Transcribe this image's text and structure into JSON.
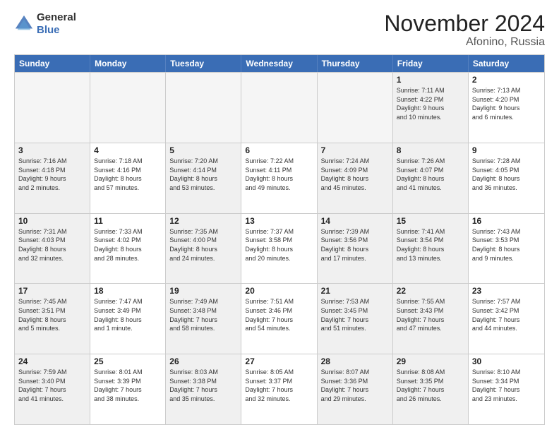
{
  "logo": {
    "line1": "General",
    "line2": "Blue"
  },
  "title": "November 2024",
  "subtitle": "Afonino, Russia",
  "calendar": {
    "headers": [
      "Sunday",
      "Monday",
      "Tuesday",
      "Wednesday",
      "Thursday",
      "Friday",
      "Saturday"
    ],
    "rows": [
      [
        {
          "day": "",
          "empty": true
        },
        {
          "day": "",
          "empty": true
        },
        {
          "day": "",
          "empty": true
        },
        {
          "day": "",
          "empty": true
        },
        {
          "day": "",
          "empty": true
        },
        {
          "day": "1",
          "text": "Sunrise: 7:11 AM\nSunset: 4:22 PM\nDaylight: 9 hours\nand 10 minutes.",
          "shaded": true
        },
        {
          "day": "2",
          "text": "Sunrise: 7:13 AM\nSunset: 4:20 PM\nDaylight: 9 hours\nand 6 minutes.",
          "shaded": false
        }
      ],
      [
        {
          "day": "3",
          "text": "Sunrise: 7:16 AM\nSunset: 4:18 PM\nDaylight: 9 hours\nand 2 minutes.",
          "shaded": true
        },
        {
          "day": "4",
          "text": "Sunrise: 7:18 AM\nSunset: 4:16 PM\nDaylight: 8 hours\nand 57 minutes.",
          "shaded": false
        },
        {
          "day": "5",
          "text": "Sunrise: 7:20 AM\nSunset: 4:14 PM\nDaylight: 8 hours\nand 53 minutes.",
          "shaded": true
        },
        {
          "day": "6",
          "text": "Sunrise: 7:22 AM\nSunset: 4:11 PM\nDaylight: 8 hours\nand 49 minutes.",
          "shaded": false
        },
        {
          "day": "7",
          "text": "Sunrise: 7:24 AM\nSunset: 4:09 PM\nDaylight: 8 hours\nand 45 minutes.",
          "shaded": true
        },
        {
          "day": "8",
          "text": "Sunrise: 7:26 AM\nSunset: 4:07 PM\nDaylight: 8 hours\nand 41 minutes.",
          "shaded": true
        },
        {
          "day": "9",
          "text": "Sunrise: 7:28 AM\nSunset: 4:05 PM\nDaylight: 8 hours\nand 36 minutes.",
          "shaded": false
        }
      ],
      [
        {
          "day": "10",
          "text": "Sunrise: 7:31 AM\nSunset: 4:03 PM\nDaylight: 8 hours\nand 32 minutes.",
          "shaded": true
        },
        {
          "day": "11",
          "text": "Sunrise: 7:33 AM\nSunset: 4:02 PM\nDaylight: 8 hours\nand 28 minutes.",
          "shaded": false
        },
        {
          "day": "12",
          "text": "Sunrise: 7:35 AM\nSunset: 4:00 PM\nDaylight: 8 hours\nand 24 minutes.",
          "shaded": true
        },
        {
          "day": "13",
          "text": "Sunrise: 7:37 AM\nSunset: 3:58 PM\nDaylight: 8 hours\nand 20 minutes.",
          "shaded": false
        },
        {
          "day": "14",
          "text": "Sunrise: 7:39 AM\nSunset: 3:56 PM\nDaylight: 8 hours\nand 17 minutes.",
          "shaded": true
        },
        {
          "day": "15",
          "text": "Sunrise: 7:41 AM\nSunset: 3:54 PM\nDaylight: 8 hours\nand 13 minutes.",
          "shaded": true
        },
        {
          "day": "16",
          "text": "Sunrise: 7:43 AM\nSunset: 3:53 PM\nDaylight: 8 hours\nand 9 minutes.",
          "shaded": false
        }
      ],
      [
        {
          "day": "17",
          "text": "Sunrise: 7:45 AM\nSunset: 3:51 PM\nDaylight: 8 hours\nand 5 minutes.",
          "shaded": true
        },
        {
          "day": "18",
          "text": "Sunrise: 7:47 AM\nSunset: 3:49 PM\nDaylight: 8 hours\nand 1 minute.",
          "shaded": false
        },
        {
          "day": "19",
          "text": "Sunrise: 7:49 AM\nSunset: 3:48 PM\nDaylight: 7 hours\nand 58 minutes.",
          "shaded": true
        },
        {
          "day": "20",
          "text": "Sunrise: 7:51 AM\nSunset: 3:46 PM\nDaylight: 7 hours\nand 54 minutes.",
          "shaded": false
        },
        {
          "day": "21",
          "text": "Sunrise: 7:53 AM\nSunset: 3:45 PM\nDaylight: 7 hours\nand 51 minutes.",
          "shaded": true
        },
        {
          "day": "22",
          "text": "Sunrise: 7:55 AM\nSunset: 3:43 PM\nDaylight: 7 hours\nand 47 minutes.",
          "shaded": true
        },
        {
          "day": "23",
          "text": "Sunrise: 7:57 AM\nSunset: 3:42 PM\nDaylight: 7 hours\nand 44 minutes.",
          "shaded": false
        }
      ],
      [
        {
          "day": "24",
          "text": "Sunrise: 7:59 AM\nSunset: 3:40 PM\nDaylight: 7 hours\nand 41 minutes.",
          "shaded": true
        },
        {
          "day": "25",
          "text": "Sunrise: 8:01 AM\nSunset: 3:39 PM\nDaylight: 7 hours\nand 38 minutes.",
          "shaded": false
        },
        {
          "day": "26",
          "text": "Sunrise: 8:03 AM\nSunset: 3:38 PM\nDaylight: 7 hours\nand 35 minutes.",
          "shaded": true
        },
        {
          "day": "27",
          "text": "Sunrise: 8:05 AM\nSunset: 3:37 PM\nDaylight: 7 hours\nand 32 minutes.",
          "shaded": false
        },
        {
          "day": "28",
          "text": "Sunrise: 8:07 AM\nSunset: 3:36 PM\nDaylight: 7 hours\nand 29 minutes.",
          "shaded": true
        },
        {
          "day": "29",
          "text": "Sunrise: 8:08 AM\nSunset: 3:35 PM\nDaylight: 7 hours\nand 26 minutes.",
          "shaded": true
        },
        {
          "day": "30",
          "text": "Sunrise: 8:10 AM\nSunset: 3:34 PM\nDaylight: 7 hours\nand 23 minutes.",
          "shaded": false
        }
      ]
    ]
  }
}
